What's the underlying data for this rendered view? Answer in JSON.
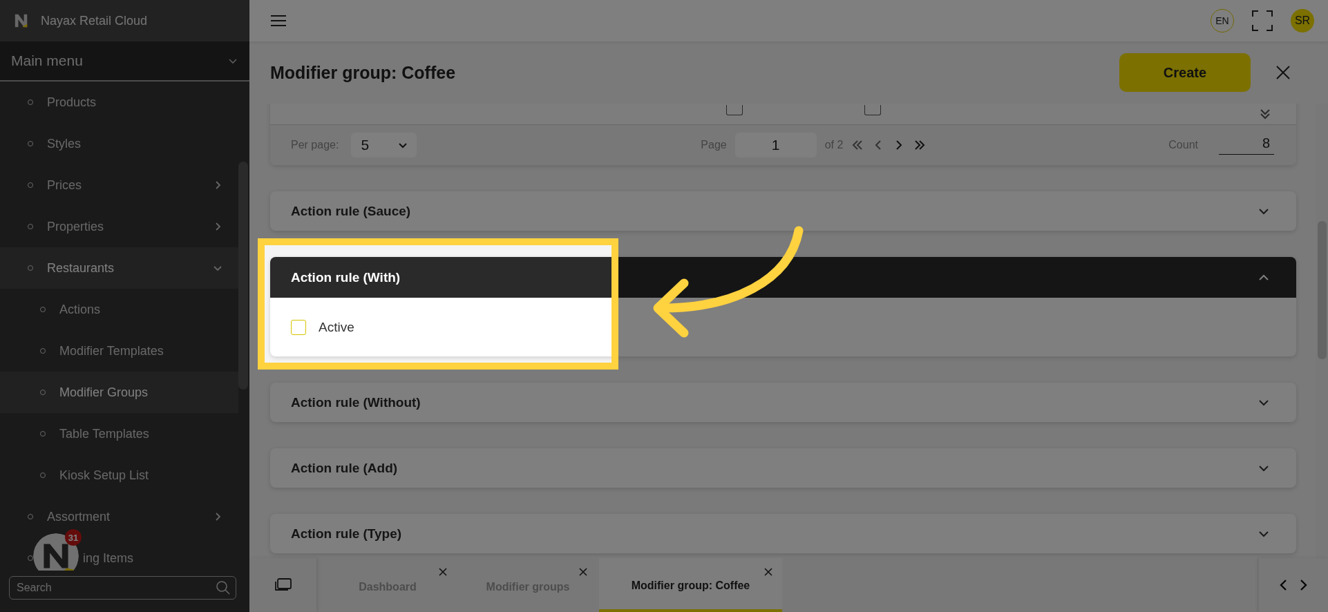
{
  "app": {
    "title": "Nayax Retail Cloud"
  },
  "sidebar": {
    "section": "Main menu",
    "expanded": true,
    "items": [
      {
        "label": "Products",
        "kind": "link",
        "selected": false
      },
      {
        "label": "Styles",
        "kind": "link",
        "selected": false
      },
      {
        "label": "Prices",
        "kind": "group",
        "expanded": false,
        "selected": false
      },
      {
        "label": "Properties",
        "kind": "group",
        "expanded": false,
        "selected": false
      },
      {
        "label": "Restaurants",
        "kind": "group",
        "expanded": true,
        "selected": true,
        "children": [
          {
            "label": "Actions",
            "selected": false
          },
          {
            "label": "Modifier Templates",
            "selected": false
          },
          {
            "label": "Modifier Groups",
            "selected": true
          },
          {
            "label": "Table Templates",
            "selected": false
          },
          {
            "label": "Kiosk Setup List",
            "selected": false
          }
        ]
      },
      {
        "label": "Assortment",
        "kind": "group",
        "expanded": false,
        "selected": false
      },
      {
        "label": "ing Items",
        "kind": "covered",
        "selected": false
      }
    ],
    "search": {
      "placeholder": "Search"
    }
  },
  "notification": {
    "count": "31"
  },
  "header": {
    "language": "EN",
    "user_initials": "SR"
  },
  "page": {
    "title": "Modifier group: Coffee",
    "create_button": "Create"
  },
  "table_row": {
    "checkboxes": [
      {
        "checked": false
      },
      {
        "checked": false
      }
    ]
  },
  "pagination": {
    "per_page_label": "Per page:",
    "per_page": "5",
    "page_label": "Page",
    "page": "1",
    "page_total": "of 2",
    "count_label": "Count",
    "count": "8"
  },
  "accordions": [
    {
      "title": "Action rule (Sauce)",
      "expanded": false
    },
    {
      "title": "Action rule (With)",
      "expanded": true,
      "fields": [
        {
          "label": "Active",
          "checked": false
        }
      ]
    },
    {
      "title": "Action rule (Without)",
      "expanded": false
    },
    {
      "title": "Action rule (Add)",
      "expanded": false
    },
    {
      "title": "Action rule (Type)",
      "expanded": false
    }
  ],
  "tabs": [
    {
      "label": "Dashboard",
      "selected": false
    },
    {
      "label": "Modifier groups",
      "selected": false
    },
    {
      "label": "Modifier group: Coffee",
      "selected": true
    }
  ]
}
